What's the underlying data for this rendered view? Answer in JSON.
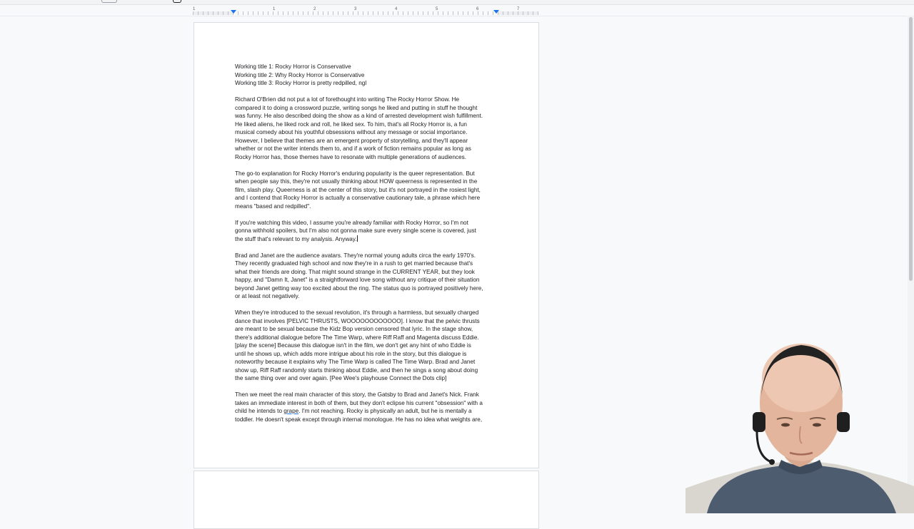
{
  "ruler": {
    "numbers": [
      "1",
      "1",
      "2",
      "3",
      "4",
      "5",
      "6",
      "7"
    ]
  },
  "document": {
    "paragraphs": [
      {
        "lines": [
          "Working title 1: Rocky Horror is Conservative",
          "Working title 2: Why Rocky Horror is Conservative",
          "Working title 3: Rocky Horror is pretty redpilled, ngl"
        ]
      },
      {
        "lines": [
          "Richard O'Brien did not put a lot of forethought into writing The Rocky Horror Show. He",
          "compared it to doing a crossword puzzle, writing songs he liked and putting in stuff he thought",
          "was funny. He also described doing the show as a kind of arrested development wish fulfillment.",
          "He liked aliens, he liked rock and roll, he liked sex. To him, that's all Rocky Horror is, a fun",
          "musical comedy about his youthful obsessions without any message or social importance.",
          "However, I believe that themes are an emergent property of storytelling, and they'll appear",
          "whether or not the writer intends them to, and if a work of fiction remains popular as long as",
          "Rocky Horror has, those themes have to resonate with multiple generations of audiences."
        ]
      },
      {
        "lines": [
          "The go-to explanation for Rocky Horror's enduring popularity is the queer representation. But",
          "when people say this, they're not usually thinking about HOW queerness is represented in the",
          "film, slash play. Queerness is at the center of this story, but it's not portrayed in the rosiest light,",
          "and I contend that Rocky Horror is actually a conservative cautionary tale, a phrase which here",
          "means \"based and redpilled\"."
        ]
      },
      {
        "lines": [
          "If you're watching this video, I assume you're already familiar with Rocky Horror, so I'm not",
          "gonna withhold spoilers, but I'm also not gonna make sure every single scene is covered, just",
          "the stuff that's relevant to my analysis. Anyway."
        ]
      },
      {
        "lines": [
          "Brad and Janet are the audience avatars. They're normal young adults circa the early 1970's.",
          "They recently graduated high school and now they're in a rush to get married because that's",
          "what their friends are doing. That might sound strange in the CURRENT YEAR, but they look",
          "happy, and \"Damn It, Janet\" is a straightforward love song without any critique of their situation",
          "beyond Janet getting way too excited about the ring. The status quo is portrayed positively here,",
          "or at least not negatively."
        ]
      },
      {
        "lines": [
          "When they're introduced to the sexual revolution, it's through a harmless, but sexually charged",
          "dance that involves [PELVIC THRUSTS, WOOOOOOOOOOOO]. I know that the pelvic thrusts",
          "are meant to be sexual because the Kidz Bop version censored that lyric. In the stage show,",
          "there's additional dialogue before The Time Warp, where Riff Raff and Magenta discuss Eddie.",
          "[play the scene] Because this dialogue isn't in the film, we don't get any hint of who Eddie is",
          "until he shows up, which adds more intrigue about his role in the story, but this dialogue is",
          "noteworthy because it explains why The Time Warp is called The Time Warp. Brad and Janet",
          "show up, Riff Raff randomly starts thinking about Eddie, and then he sings a song about doing",
          "the same thing over and over again. [Pee Wee's playhouse Connect the Dots clip]"
        ]
      },
      {
        "lines": [
          "Then we meet the real main character of this story, the Gatsby to Brad and Janet's Nick. Frank",
          "takes an immediate interest in both of them, but they don't eclipse his current \"obsession\" with a",
          "child he intends to grape. I'm not reaching. Rocky is physically an adult, but he is mentally a",
          "toddler. He doesn't speak except through internal monologue. He has no idea what weights are,"
        ]
      }
    ],
    "underlined_word": "grape"
  },
  "colors": {
    "page_bg": "#ffffff",
    "canvas_bg": "#f8f9fa",
    "text": "#202124",
    "accent": "#1a73e8"
  }
}
